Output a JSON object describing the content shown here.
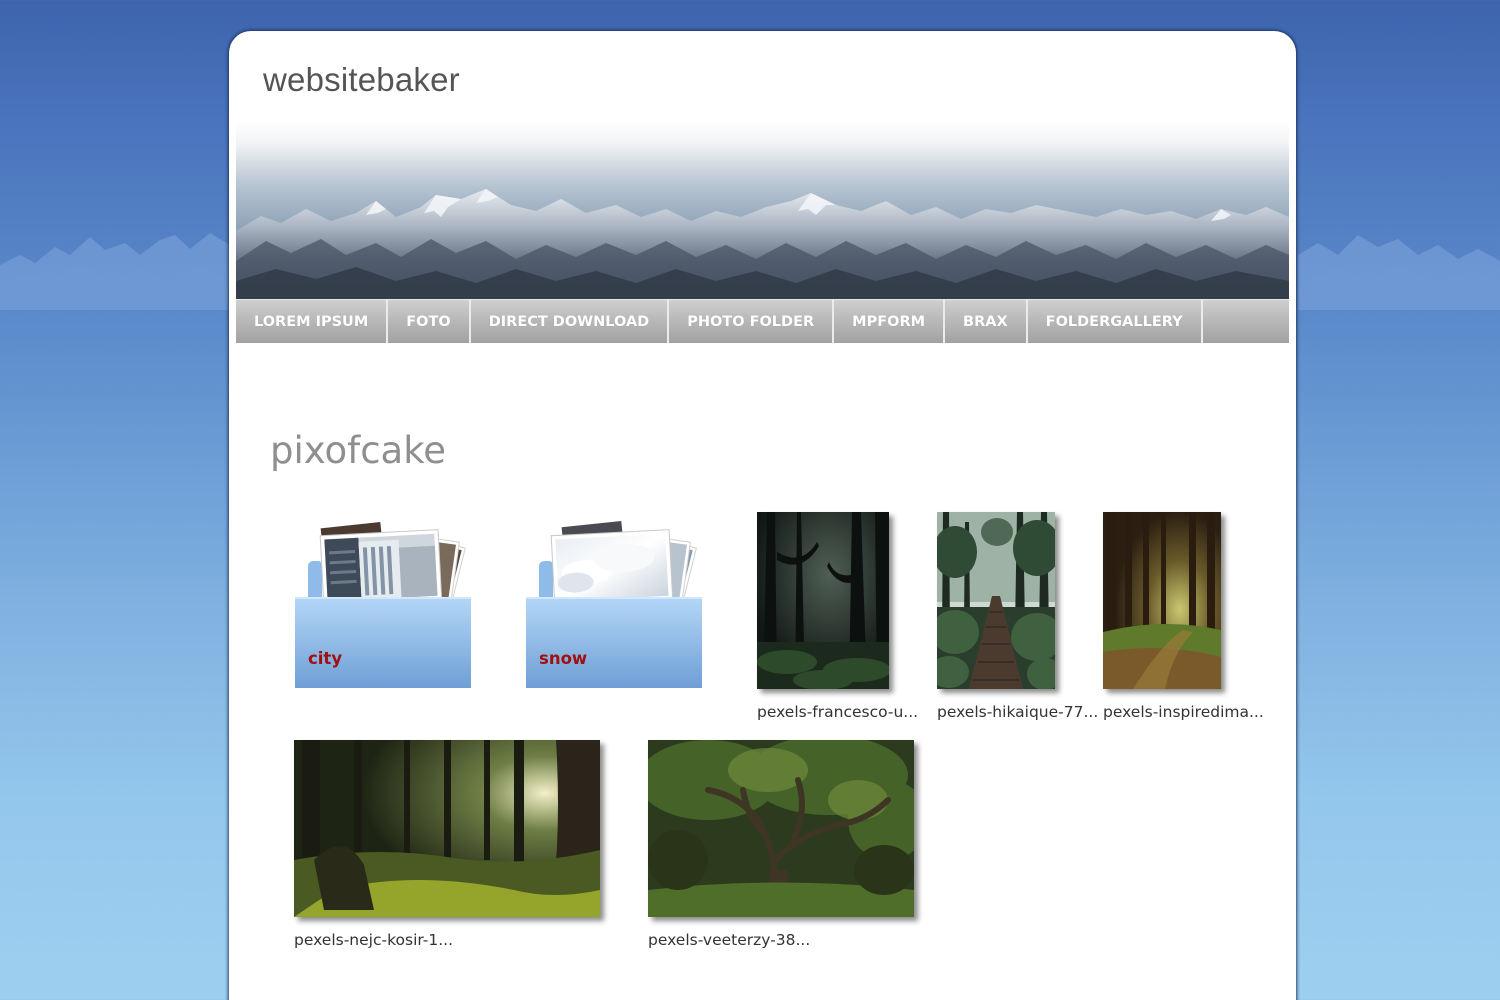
{
  "site": {
    "title": "websitebaker"
  },
  "nav": {
    "items": [
      {
        "label": "LOREM IPSUM"
      },
      {
        "label": "FOTO"
      },
      {
        "label": "DIRECT DOWNLOAD"
      },
      {
        "label": "PHOTO FOLDER"
      },
      {
        "label": "MPFORM"
      },
      {
        "label": "BRAX"
      },
      {
        "label": "FOLDERGALLERY"
      }
    ]
  },
  "main": {
    "heading": "pixofcake",
    "folders": [
      {
        "label": "city"
      },
      {
        "label": "snow"
      }
    ],
    "images": [
      {
        "caption": "pexels-francesco-u..."
      },
      {
        "caption": "pexels-hikaique-77..."
      },
      {
        "caption": "pexels-inspiredima..."
      },
      {
        "caption": "pexels-nejc-kosir-1..."
      },
      {
        "caption": "pexels-veeterzy-38..."
      }
    ]
  },
  "colors": {
    "folder_label": "#a01010",
    "nav_background": "#b9b9b9",
    "heading": "#8f8f8f"
  },
  "icons": {
    "folder": "folder-icon"
  }
}
